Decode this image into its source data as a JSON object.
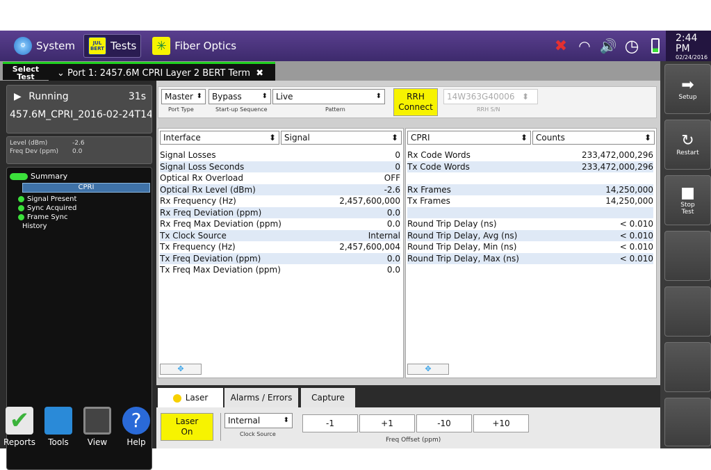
{
  "topbar": {
    "system_label": "System",
    "tests_label": "Tests",
    "tests_icon_text": "JUL BERT",
    "fiber_label": "Fiber Optics",
    "clock_time": "2:44 PM",
    "clock_date": "02/24/2016"
  },
  "subbar": {
    "select_test": "Select Test",
    "port_tab": "Port 1: 2457.6M CPRI Layer 2 BERT Term"
  },
  "left": {
    "status": "Running",
    "elapsed": "31s",
    "filename": "457.6M_CPRI_2016-02-24T14",
    "level_label": "Level (dBm)",
    "level_value": "-2.6",
    "freqdev_label": "Freq Dev (ppm)",
    "freqdev_value": "0.0",
    "tree": {
      "summary": "Summary",
      "cpri": "CPRI",
      "signal_present": "Signal Present",
      "sync_acquired": "Sync Acquired",
      "frame_sync": "Frame Sync",
      "history": "History"
    },
    "bottom": {
      "reports": "Reports",
      "tools": "Tools",
      "view": "View",
      "help": "Help"
    }
  },
  "controls": {
    "port_type_value": "Master",
    "port_type_label": "Port Type",
    "startup_value": "Bypass",
    "startup_label": "Start-up Sequence",
    "pattern_value": "Live",
    "pattern_label": "Pattern",
    "rrh_connect_line1": "RRH",
    "rrh_connect_line2": "Connect",
    "rrh_sn_value": "14W363G40006",
    "rrh_sn_label": "RRH S/N"
  },
  "left_table": {
    "group": "Interface",
    "category": "Signal",
    "rows": [
      {
        "label": "Signal Losses",
        "value": "0"
      },
      {
        "label": "Signal Loss Seconds",
        "value": "0"
      },
      {
        "label": "Optical Rx Overload",
        "value": "OFF"
      },
      {
        "label": "Optical Rx Level (dBm)",
        "value": "-2.6"
      },
      {
        "label": "Rx Frequency (Hz)",
        "value": "2,457,600,000"
      },
      {
        "label": "Rx Freq Deviation (ppm)",
        "value": "0.0"
      },
      {
        "label": "Rx Freq Max Deviation (ppm)",
        "value": "0.0"
      },
      {
        "label": "Tx Clock Source",
        "value": "Internal"
      },
      {
        "label": "Tx Frequency (Hz)",
        "value": "2,457,600,004"
      },
      {
        "label": "Tx Freq Deviation (ppm)",
        "value": "0.0"
      },
      {
        "label": "Tx Freq Max Deviation (ppm)",
        "value": "0.0"
      }
    ]
  },
  "right_table": {
    "group": "CPRI",
    "category": "Counts",
    "rows": [
      {
        "label": "Rx Code Words",
        "value": "233,472,000,296"
      },
      {
        "label": "Tx Code Words",
        "value": "233,472,000,296"
      },
      {
        "label": "",
        "value": ""
      },
      {
        "label": "Rx Frames",
        "value": "14,250,000"
      },
      {
        "label": "Tx Frames",
        "value": "14,250,000"
      },
      {
        "label": "",
        "value": ""
      },
      {
        "label": "Round Trip Delay (ns)",
        "value": "< 0.010"
      },
      {
        "label": "Round Trip Delay, Avg (ns)",
        "value": "< 0.010"
      },
      {
        "label": "Round Trip Delay, Min (ns)",
        "value": "< 0.010"
      },
      {
        "label": "Round Trip Delay, Max (ns)",
        "value": "< 0.010"
      }
    ]
  },
  "bottom_tabs": {
    "laser": "Laser",
    "alarms": "Alarms / Errors",
    "capture": "Capture"
  },
  "laser_bar": {
    "laser_on_line1": "Laser",
    "laser_on_line2": "On",
    "clock_source_value": "Internal",
    "clock_source_label": "Clock Source",
    "btn_m1": "-1",
    "btn_p1": "+1",
    "btn_m10": "-10",
    "btn_p10": "+10",
    "freq_offset_label": "Freq Offset (ppm)"
  },
  "right_buttons": {
    "setup": "Setup",
    "restart": "Restart",
    "stop_test_line1": "Stop",
    "stop_test_line2": "Test"
  },
  "colors": {
    "accent_purple": "#4b3580",
    "highlight_yellow": "#f7f300",
    "status_green": "#3be03b",
    "row_alt_blue": "#dfe9f6"
  }
}
